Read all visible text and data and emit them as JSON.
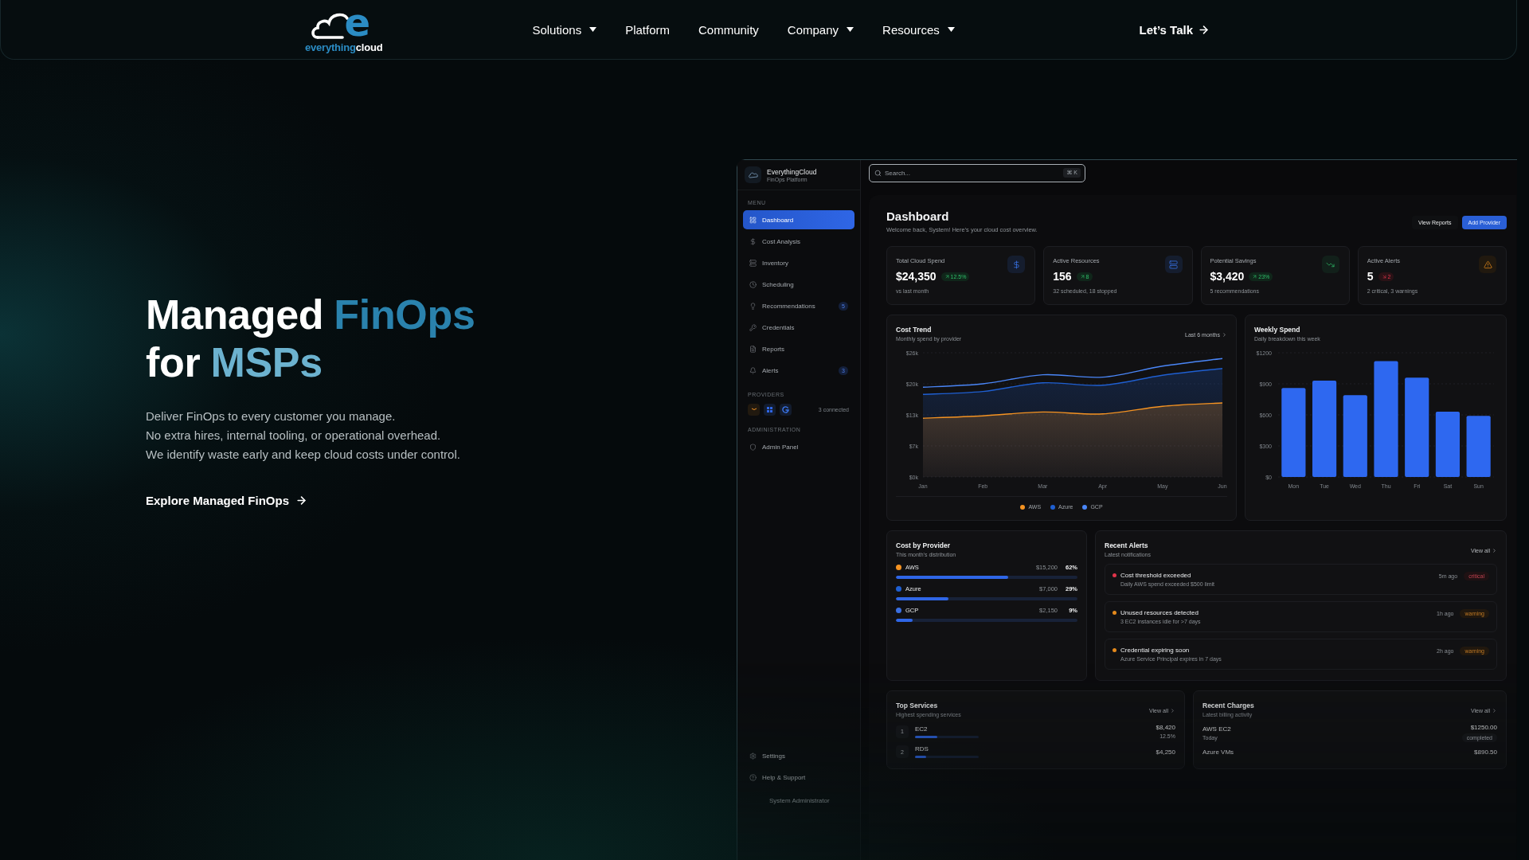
{
  "navbar": {
    "logo": {
      "mark": "e",
      "parts": [
        "everything",
        "cloud"
      ]
    },
    "links": [
      {
        "label": "Solutions",
        "dropdown": true
      },
      {
        "label": "Platform",
        "dropdown": false
      },
      {
        "label": "Community",
        "dropdown": false
      },
      {
        "label": "Company",
        "dropdown": true
      },
      {
        "label": "Resources",
        "dropdown": true
      }
    ],
    "cta": "Let’s Talk"
  },
  "hero": {
    "headline": [
      [
        {
          "text": "Managed",
          "color": "#ffffff"
        },
        {
          "text": "FinOps",
          "color": "#2a82ad"
        }
      ],
      [
        {
          "text": "for",
          "color": "#ffffff"
        },
        {
          "text": "MSPs",
          "color": "#6cb2cf"
        }
      ]
    ],
    "lines": [
      "Deliver FinOps to every customer you manage.",
      "No extra hires, internal tooling, or operational overhead.",
      "We identify waste early and keep cloud costs under control."
    ],
    "link": "Explore Managed FinOps"
  },
  "app": {
    "brand": {
      "name": "EverythingCloud",
      "sub": "FinOps Platform"
    },
    "search": {
      "placeholder": "Search...",
      "shortcut": "⌘ K"
    },
    "menu_label": "MENU",
    "menu": [
      {
        "label": "Dashboard",
        "selected": true
      },
      {
        "label": "Cost Analysis",
        "selected": false
      },
      {
        "label": "Inventory",
        "selected": false
      },
      {
        "label": "Scheduling",
        "selected": false
      },
      {
        "label": "Recommendations",
        "selected": false,
        "badge": "5"
      },
      {
        "label": "Credentials",
        "selected": false
      },
      {
        "label": "Reports",
        "selected": false
      },
      {
        "label": "Alerts",
        "selected": false,
        "badge": "3"
      }
    ],
    "providers_label": "PROVIDERS",
    "providers_status": "3 connected",
    "admin_label": "ADMINISTRATION",
    "admin": [
      {
        "label": "Admin Panel"
      }
    ],
    "footer_menu": [
      {
        "label": "Settings"
      },
      {
        "label": "Help & Support"
      }
    ],
    "user": "System Administrator",
    "title": "Dashboard",
    "subtitle": "Welcome back, System! Here's your cloud cost overview.",
    "actions": [
      {
        "label": "View Reports",
        "primary": false
      },
      {
        "label": "Add Provider",
        "primary": true
      }
    ],
    "stats": [
      {
        "title": "Total Cloud Spend",
        "value": "$24,350",
        "change": "12.5%",
        "rising": true,
        "note": "vs last month"
      },
      {
        "title": "Active Resources",
        "value": "156",
        "change": "8",
        "rising": true,
        "note": "32 scheduled, 18 stopped"
      },
      {
        "title": "Potential Savings",
        "value": "$3,420",
        "change": "23%",
        "rising": true,
        "note": "5 recommendations"
      },
      {
        "title": "Active Alerts",
        "value": "5",
        "change": "2",
        "rising": false,
        "note": "2 critical, 3 warnings"
      }
    ],
    "cost_trend": {
      "title": "Cost Trend",
      "subtitle": "Monthly spend by provider",
      "range": "Last 6 months",
      "chart_data": {
        "type": "area",
        "grid": true,
        "categories": [
          "Jan",
          "Feb",
          "Mar",
          "Apr",
          "May",
          "Jun"
        ],
        "series": [
          {
            "name": "AWS",
            "color": "#f59322",
            "values": [
              12.3,
              12.8,
              13.6,
              13.2,
              14.8,
              15.5
            ]
          },
          {
            "name": "Azure",
            "color": "#1f5fd1",
            "values": [
              17.3,
              17.9,
              19.7,
              19.2,
              21.3,
              22.7
            ]
          },
          {
            "name": "GCP",
            "type": "line",
            "color": "#4a86f7",
            "values": [
              18.8,
              19.5,
              21.4,
              20.9,
              23.2,
              24.8
            ]
          }
        ],
        "ylim": [
          0,
          26
        ],
        "yticks": [
          {
            "value": 0,
            "label": "$0k"
          },
          {
            "value": 6.5,
            "label": "$7k"
          },
          {
            "value": 13,
            "label": "$13k"
          },
          {
            "value": 19.5,
            "label": "$20k"
          },
          {
            "value": 26,
            "label": "$26k"
          }
        ]
      }
    },
    "weekly": {
      "title": "Weekly Spend",
      "subtitle": "Daily breakdown this week",
      "chart_data": {
        "type": "bar",
        "grid": true,
        "categories": [
          "Mon",
          "Tue",
          "Wed",
          "Thu",
          "Fri",
          "Sat",
          "Sun"
        ],
        "series": [
          {
            "color": "#2e68f0",
            "values": [
              860,
              930,
              790,
              1120,
              960,
              630,
              590
            ]
          }
        ],
        "ylim": [
          0,
          1200
        ],
        "yticks": [
          {
            "value": 0,
            "label": "$0"
          },
          {
            "value": 300,
            "label": "$300"
          },
          {
            "value": 600,
            "label": "$600"
          },
          {
            "value": 900,
            "label": "$900"
          },
          {
            "value": 1200,
            "label": "$1200"
          }
        ]
      }
    },
    "providers": {
      "title": "Cost by Provider",
      "subtitle": "This month's distribution",
      "rows": [
        {
          "name": "AWS",
          "color": "#f59322",
          "amount": "$15,200",
          "share": "62%",
          "level": 0.62
        },
        {
          "name": "Azure",
          "color": "#1f5fd1",
          "amount": "$7,000",
          "share": "29%",
          "level": 0.29
        },
        {
          "name": "GCP",
          "color": "#3b6fe0",
          "amount": "$2,150",
          "share": "9%",
          "level": 0.09
        }
      ]
    },
    "alerts": {
      "title": "Recent Alerts",
      "subtitle": "Latest notifications",
      "link": "View all",
      "items": [
        {
          "title": "Cost threshold exceeded",
          "detail": "Daily AWS spend exceeded $500 limit",
          "time": "5m ago",
          "badge": "critical",
          "critical": true,
          "color": "#e0344a"
        },
        {
          "title": "Unused resources detected",
          "detail": "3 EC2 instances idle for >7 days",
          "time": "1h ago",
          "badge": "warning",
          "critical": false,
          "color": "#e58a1c"
        },
        {
          "title": "Credential expiring soon",
          "detail": "Azure Service Principal expires in 7 days",
          "time": "2h ago",
          "badge": "warning",
          "critical": false,
          "color": "#e58a1c"
        }
      ]
    },
    "top_services": {
      "title": "Top Services",
      "subtitle": "Highest spending services",
      "link": "View all",
      "rows": [
        {
          "rank": "1",
          "name": "EC2",
          "amount": "$8,420",
          "change": "12.5%",
          "level": 0.35
        },
        {
          "rank": "2",
          "name": "RDS",
          "amount": "$4,250",
          "level": 0.18
        }
      ]
    },
    "recent_charges": {
      "title": "Recent Charges",
      "subtitle": "Latest billing activity",
      "link": "View all",
      "rows": [
        {
          "name": "AWS EC2",
          "date": "Today",
          "amount": "$1250.00",
          "status": "completed"
        },
        {
          "name": "Azure VMs",
          "amount": "$890.50"
        }
      ]
    }
  }
}
